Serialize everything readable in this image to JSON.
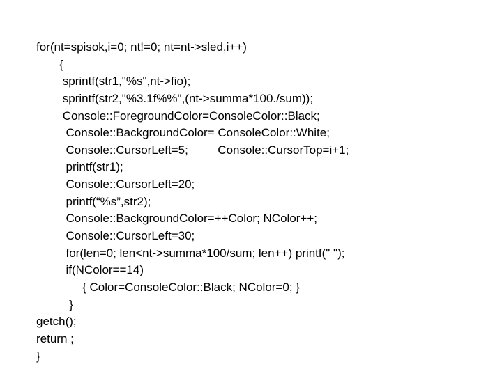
{
  "code": {
    "l1": "for(nt=spisok,i=0; nt!=0; nt=nt->sled,i++)",
    "l2": "       {",
    "l3": "        sprintf(str1,\"%s\",nt->fio);",
    "l4": "        sprintf(str2,\"%3.1f%%\",(nt->summa*100./sum));",
    "l5": "        Console::ForegroundColor=ConsoleColor::Black;",
    "l6": "         Console::BackgroundColor= ConsoleColor::White;",
    "l7": "         Console::CursorLeft=5;         Console::CursorTop=i+1;",
    "l8": "         printf(str1);",
    "l9": "         Console::CursorLeft=20;",
    "l10": "         printf(“%s”,str2);",
    "l11": "         Console::BackgroundColor=++Color; NColor++;",
    "l12": "         Console::CursorLeft=30;",
    "l13": "         for(len=0; len<nt->summa*100/sum; len++) printf(\" \");",
    "l14": "         if(NColor==14)",
    "l15": "              { Color=ConsoleColor::Black; NColor=0; }",
    "l16": "          }",
    "l17": "getch();",
    "l18": "return ;",
    "l19": "}"
  }
}
